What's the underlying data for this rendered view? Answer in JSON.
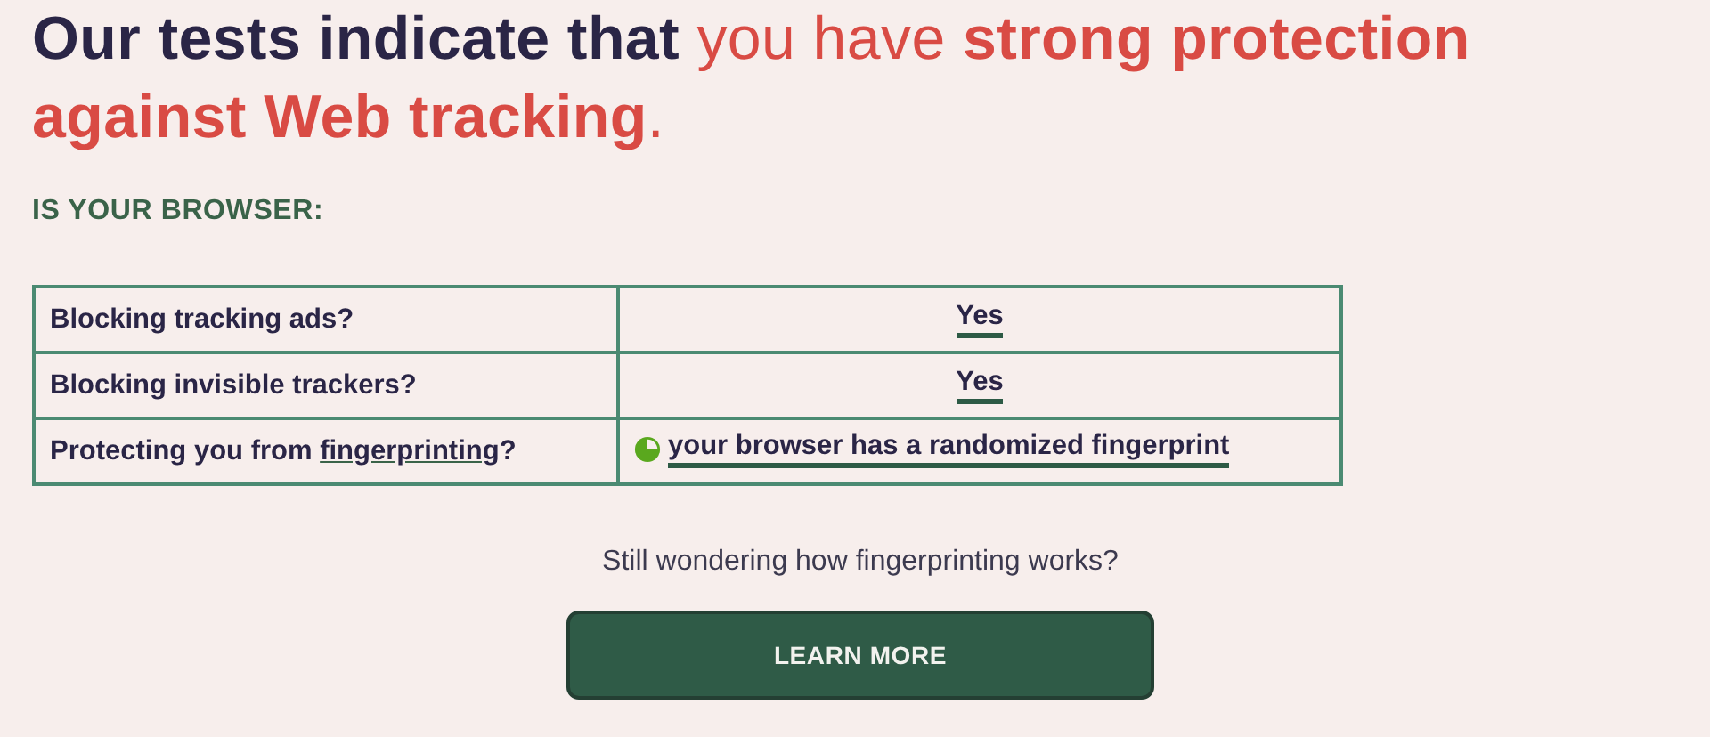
{
  "heading": {
    "lead": "Our tests indicate that",
    "result": "you have **strong protection against Web tracking**."
  },
  "subheading": "IS YOUR BROWSER:",
  "results": [
    {
      "question": "Blocking tracking ads?",
      "answer": "Yes",
      "kind": "plain"
    },
    {
      "question": "Blocking invisible trackers?",
      "answer": "Yes",
      "kind": "plain"
    },
    {
      "question": "Protecting you from",
      "link": "fingerprinting",
      "question_end": "?",
      "answer": "your browser has a randomized fingerprint",
      "kind": "status",
      "color": "#5aa81e"
    }
  ],
  "prompt": "Still wondering how fingerprinting works?",
  "button": "LEARN MORE"
}
